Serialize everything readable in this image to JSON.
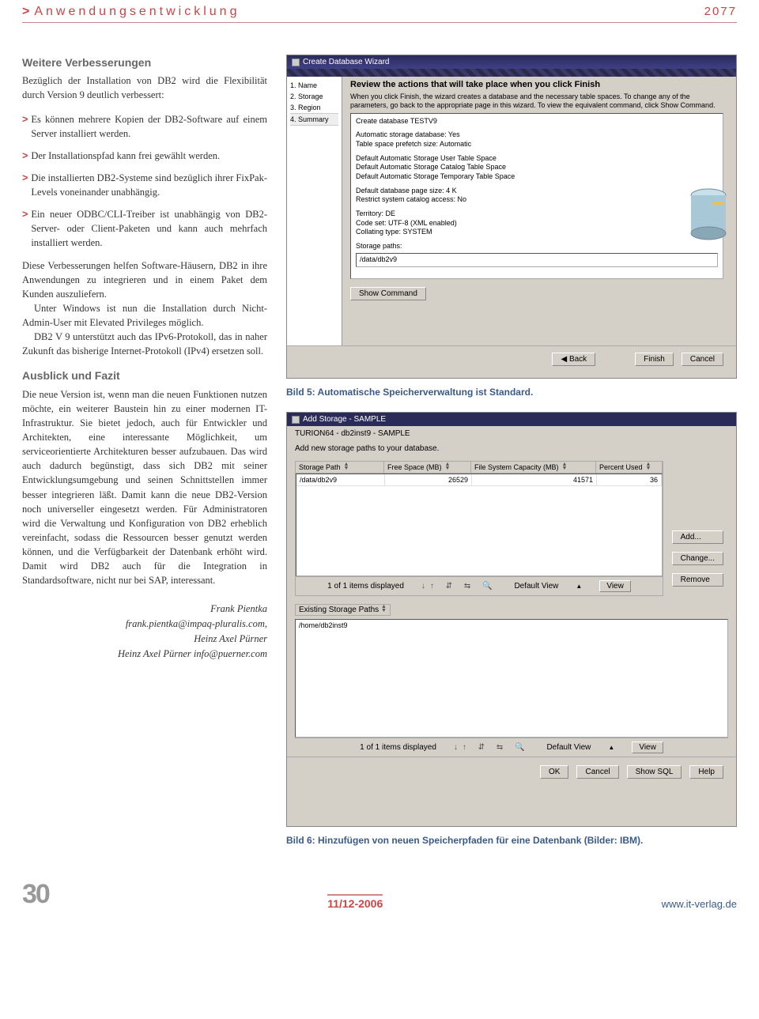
{
  "header": {
    "category": "Anwendungsentwicklung",
    "year": "2077"
  },
  "article": {
    "section1_title": "Weitere Verbesserungen",
    "intro": "Bezüglich der Installation von DB2 wird die Flexibilität durch Version 9 deutlich verbessert:",
    "bullets": [
      "Es können mehrere Kopien der DB2-Software auf einem Server installiert werden.",
      "Der Installationspfad kann frei gewählt werden.",
      "Die installierten DB2-Systeme sind bezüglich ihrer FixPak-Levels voneinander unabhängig.",
      "Ein neuer ODBC/CLI-Treiber ist unabhängig von DB2-Server- oder Client-Paketen und kann auch mehrfach installiert werden."
    ],
    "para2": "Diese Verbesserungen helfen Software-Häusern, DB2 in ihre Anwendungen zu integrieren und in einem Paket dem Kunden auszuliefern.",
    "para3": "Unter Windows ist nun die Installation durch Nicht-Admin-User mit Elevated Privileges möglich.",
    "para4": "DB2 V 9 unterstützt auch das IPv6-Protokoll, das in naher Zukunft das bisherige Internet-Protokoll (IPv4) ersetzen soll.",
    "section2_title": "Ausblick und Fazit",
    "para5": "Die neue Version ist, wenn man die neuen Funktionen nutzen möchte, ein weiterer Baustein hin zu einer modernen IT-Infrastruktur. Sie bietet jedoch, auch für Entwickler und Architekten, eine interessante Möglichkeit, um serviceorientierte Architekturen besser aufzubauen. Das wird auch dadurch begünstigt, dass sich DB2 mit seiner Entwicklungsumgebung und seinen Schnittstellen immer besser integrieren läßt. Damit kann die neue DB2-Version noch universeller eingesetzt werden. Für Administratoren wird die Verwaltung und Konfiguration von DB2 erheblich vereinfacht, sodass die Ressourcen besser genutzt werden können, und die Verfügbarkeit der Datenbank erhöht wird. Damit wird DB2 auch für die Integration in Standardsoftware, nicht nur bei SAP, interessant.",
    "authors": {
      "a1": "Frank Pientka",
      "e1": "frank.pientka@impaq-pluralis.com,",
      "a2": "Heinz Axel Pürner",
      "e2": "Heinz Axel Pürner info@puerner.com"
    }
  },
  "fig5": {
    "caption": "Bild 5: Automatische Speicherverwaltung ist Standard.",
    "titlebar": "Create Database Wizard",
    "steps": [
      "1. Name",
      "2. Storage",
      "3. Region",
      "4. Summary"
    ],
    "main_title": "Review the actions that will take place when you click Finish",
    "help": "When you click Finish, the wizard creates a database and the necessary table spaces. To change any of the parameters, go back to the appropriate page in this wizard. To view the equivalent command, click Show Command.",
    "review": {
      "l1": "Create database TESTV9",
      "l2": "Automatic storage database: Yes",
      "l3": "Table space prefetch size: Automatic",
      "l4": "Default Automatic Storage User Table Space",
      "l5": "Default Automatic Storage Catalog Table Space",
      "l6": "Default Automatic Storage Temporary Table Space",
      "l7": "Default database page size: 4 K",
      "l8": "Restrict system catalog access: No",
      "l9": "Territory: DE",
      "l10": "Code set: UTF-8 (XML enabled)",
      "l11": "Collating type: SYSTEM",
      "l12": "Storage paths:",
      "path": "/data/db2v9"
    },
    "btn_showcmd": "Show Command",
    "btn_back": "◀ Back",
    "btn_finish": "Finish",
    "btn_cancel": "Cancel"
  },
  "fig6": {
    "caption": "Bild 6: Hinzufügen von neuen Speicherpfaden für eine Datenbank (Bilder: IBM).",
    "titlebar": "Add Storage - SAMPLE",
    "subtitle": "TURION64 - db2inst9 - SAMPLE",
    "instruction": "Add new storage paths to your database.",
    "cols": [
      "Storage Path",
      "Free Space (MB)",
      "File System Capacity (MB)",
      "Percent Used"
    ],
    "row": {
      "c0": "/data/db2v9",
      "c1": "26529",
      "c2": "41571",
      "c3": "36"
    },
    "btn_add": "Add...",
    "btn_change": "Change...",
    "btn_remove": "Remove",
    "status1": "1 of 1 items displayed",
    "default_view": "Default View",
    "btn_view": "View",
    "existing_label": "Existing Storage Paths",
    "existing_row": "/home/db2inst9",
    "btn_ok": "OK",
    "btn_cancel": "Cancel",
    "btn_showsql": "Show SQL",
    "btn_help": "Help"
  },
  "footer": {
    "pagenum": "30",
    "issue": "11/12-2006",
    "site": "www.it-verlag.de"
  }
}
